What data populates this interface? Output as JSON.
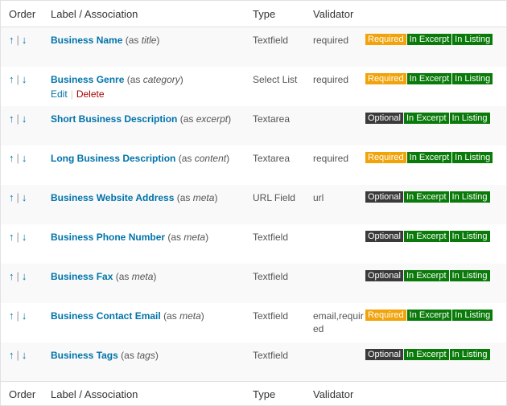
{
  "header": {
    "order": "Order",
    "label": "Label / Association",
    "type": "Type",
    "validator": "Validator"
  },
  "arrows": {
    "up": "↑",
    "sep": "|",
    "down": "↓"
  },
  "actions": {
    "edit": "Edit",
    "sep": "|",
    "delete": "Delete"
  },
  "assoc_prefix": "(as ",
  "assoc_suffix": ")",
  "badges": {
    "required": "Required",
    "optional": "Optional",
    "in_excerpt": "In Excerpt",
    "in_listing": "In Listing"
  },
  "colors": {
    "required": "#f0a30a",
    "optional": "#3a3a3a",
    "green": "#0a7a0a",
    "link": "#0073aa",
    "delete": "#a00000"
  },
  "rows": [
    {
      "name": "Business Name",
      "as": "title",
      "type": "Textfield",
      "validator": "required",
      "badges": [
        "required",
        "in_excerpt",
        "in_listing"
      ],
      "actions": false
    },
    {
      "name": "Business Genre",
      "as": "category",
      "type": "Select List",
      "validator": "required",
      "badges": [
        "required",
        "in_excerpt",
        "in_listing"
      ],
      "actions": true
    },
    {
      "name": "Short Business Description",
      "as": "excerpt",
      "type": "Textarea",
      "validator": "",
      "badges": [
        "optional",
        "in_excerpt",
        "in_listing"
      ],
      "actions": false
    },
    {
      "name": "Long Business Description",
      "as": "content",
      "type": "Textarea",
      "validator": "required",
      "badges": [
        "required",
        "in_excerpt",
        "in_listing"
      ],
      "actions": false
    },
    {
      "name": "Business Website Address",
      "as": "meta",
      "type": "URL Field",
      "validator": "url",
      "badges": [
        "optional",
        "in_excerpt",
        "in_listing"
      ],
      "actions": false
    },
    {
      "name": "Business Phone Number",
      "as": "meta",
      "type": "Textfield",
      "validator": "",
      "badges": [
        "optional",
        "in_excerpt",
        "in_listing"
      ],
      "actions": false
    },
    {
      "name": "Business Fax",
      "as": "meta",
      "type": "Textfield",
      "validator": "",
      "badges": [
        "optional",
        "in_excerpt",
        "in_listing"
      ],
      "actions": false
    },
    {
      "name": "Business Contact Email",
      "as": "meta",
      "type": "Textfield",
      "validator": "email,required",
      "badges": [
        "required",
        "in_excerpt",
        "in_listing"
      ],
      "actions": false
    },
    {
      "name": "Business Tags",
      "as": "tags",
      "type": "Textfield",
      "validator": "",
      "badges": [
        "optional",
        "in_excerpt",
        "in_listing"
      ],
      "actions": false
    }
  ]
}
